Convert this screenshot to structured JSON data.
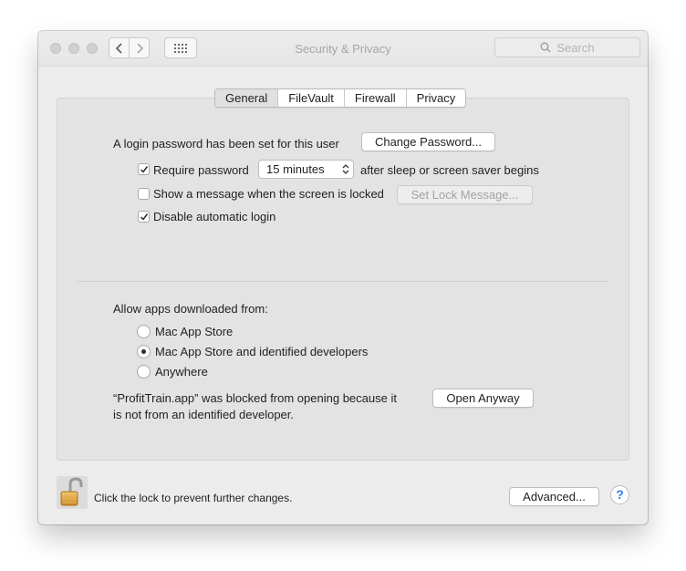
{
  "window": {
    "title": "Security & Privacy"
  },
  "toolbar": {
    "search_placeholder": "Search"
  },
  "tabs": [
    {
      "label": "General",
      "selected": true
    },
    {
      "label": "FileVault",
      "selected": false
    },
    {
      "label": "Firewall",
      "selected": false
    },
    {
      "label": "Privacy",
      "selected": false
    }
  ],
  "general": {
    "login_text": "A login password has been set for this user",
    "change_password_label": "Change Password...",
    "require_password": {
      "label": "Require password",
      "checked": true
    },
    "require_password_delay": "15 minutes",
    "after_sleep_text": "after sleep or screen saver begins",
    "show_message": {
      "label": "Show a message when the screen is locked",
      "checked": false
    },
    "set_lock_message_label": "Set Lock Message...",
    "disable_auto_login": {
      "label": "Disable automatic login",
      "checked": true
    }
  },
  "apps": {
    "heading": "Allow apps downloaded from:",
    "options": [
      {
        "label": "Mac App Store",
        "selected": false
      },
      {
        "label": "Mac App Store and identified developers",
        "selected": true
      },
      {
        "label": "Anywhere",
        "selected": false
      }
    ],
    "blocked_line1": "“ProfitTrain.app” was blocked from opening because it",
    "blocked_line2": "is not from an identified developer.",
    "open_anyway_label": "Open Anyway"
  },
  "footer": {
    "lock_text": "Click the lock to prevent further changes.",
    "advanced_label": "Advanced...",
    "help_label": "?"
  },
  "colors": {
    "accent": "#2d7cf6",
    "lock_gold": "#e0a040"
  }
}
